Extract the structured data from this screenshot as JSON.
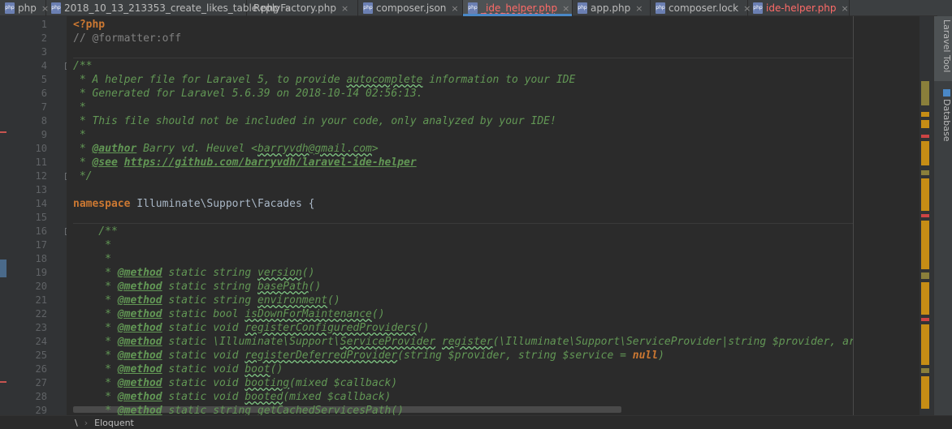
{
  "tabs": [
    {
      "label": "php",
      "icon": "php-file-icon",
      "active": false,
      "error": false
    },
    {
      "label": "2018_10_13_213353_create_likes_table.php",
      "icon": "php-file-icon",
      "active": false,
      "error": false
    },
    {
      "label": "ReplyFactory.php",
      "icon": "",
      "active": false,
      "error": false
    },
    {
      "label": "composer.json",
      "icon": "json-file-icon",
      "active": false,
      "error": false
    },
    {
      "label": "_ide_helper.php",
      "icon": "php-file-icon",
      "active": true,
      "error": true
    },
    {
      "label": "app.php",
      "icon": "php-file-icon",
      "active": false,
      "error": false
    },
    {
      "label": "composer.lock",
      "icon": "lock-file-icon",
      "active": false,
      "error": false
    },
    {
      "label": "ide-helper.php",
      "icon": "php-file-icon",
      "active": false,
      "error": true
    }
  ],
  "close_glyph": "×",
  "file_icon_text": "php",
  "line_numbers": [
    "1",
    "2",
    "3",
    "4",
    "5",
    "6",
    "7",
    "8",
    "9",
    "10",
    "11",
    "12",
    "13",
    "14",
    "15",
    "16",
    "17",
    "18",
    "19",
    "20",
    "21",
    "22",
    "23",
    "24",
    "25",
    "26",
    "27",
    "28",
    "29"
  ],
  "code_lines": [
    [
      {
        "t": "<?php",
        "c": "kw"
      }
    ],
    [
      {
        "t": "// @formatter:off",
        "c": "cmt"
      }
    ],
    [],
    [
      {
        "t": "/**",
        "c": "doc"
      }
    ],
    [
      {
        "t": " * A helper file for Laravel 5, to provide ",
        "c": "doc"
      },
      {
        "t": "autocomplete",
        "c": "doc-ref"
      },
      {
        "t": " information to your IDE",
        "c": "doc"
      }
    ],
    [
      {
        "t": " * Generated for Laravel 5.6.39 on 2018-10-14 02:56:13.",
        "c": "doc"
      }
    ],
    [
      {
        "t": " *",
        "c": "doc"
      }
    ],
    [
      {
        "t": " * This file should not be included in your code, only analyzed by your IDE!",
        "c": "doc"
      }
    ],
    [
      {
        "t": " *",
        "c": "doc"
      }
    ],
    [
      {
        "t": " * ",
        "c": "doc"
      },
      {
        "t": "@author",
        "c": "tag"
      },
      {
        "t": " Barry vd. Heuvel <",
        "c": "doc"
      },
      {
        "t": "barryvdh@gmail.com",
        "c": "doc-ref"
      },
      {
        "t": ">",
        "c": "doc"
      }
    ],
    [
      {
        "t": " * ",
        "c": "doc"
      },
      {
        "t": "@see",
        "c": "tag"
      },
      {
        "t": " ",
        "c": "doc"
      },
      {
        "t": "https://github.com/barryvdh/laravel-ide-helper",
        "c": "doc-link"
      }
    ],
    [
      {
        "t": " */",
        "c": "doc"
      }
    ],
    [],
    [
      {
        "t": "namespace",
        "c": "kw"
      },
      {
        "t": " Illuminate\\Support\\Facades {",
        "c": ""
      }
    ],
    [],
    [
      {
        "t": "    /**",
        "c": "doc"
      }
    ],
    [
      {
        "t": "     *",
        "c": "doc"
      }
    ],
    [
      {
        "t": "     *",
        "c": "doc"
      }
    ],
    [
      {
        "t": "     * ",
        "c": "doc"
      },
      {
        "t": "@method",
        "c": "tag"
      },
      {
        "t": " static string ",
        "c": "doc"
      },
      {
        "t": "version",
        "c": "doc-ref"
      },
      {
        "t": "()",
        "c": "doc"
      }
    ],
    [
      {
        "t": "     * ",
        "c": "doc"
      },
      {
        "t": "@method",
        "c": "tag"
      },
      {
        "t": " static string ",
        "c": "doc"
      },
      {
        "t": "basePath",
        "c": "doc-ref"
      },
      {
        "t": "()",
        "c": "doc"
      }
    ],
    [
      {
        "t": "     * ",
        "c": "doc"
      },
      {
        "t": "@method",
        "c": "tag"
      },
      {
        "t": " static string ",
        "c": "doc"
      },
      {
        "t": "environment",
        "c": "doc-ref"
      },
      {
        "t": "()",
        "c": "doc"
      }
    ],
    [
      {
        "t": "     * ",
        "c": "doc"
      },
      {
        "t": "@method",
        "c": "tag"
      },
      {
        "t": " static bool ",
        "c": "doc"
      },
      {
        "t": "isDownForMaintenance",
        "c": "doc-ref"
      },
      {
        "t": "()",
        "c": "doc"
      }
    ],
    [
      {
        "t": "     * ",
        "c": "doc"
      },
      {
        "t": "@method",
        "c": "tag"
      },
      {
        "t": " static void ",
        "c": "doc"
      },
      {
        "t": "registerConfiguredProviders",
        "c": "doc-ref"
      },
      {
        "t": "()",
        "c": "doc"
      }
    ],
    [
      {
        "t": "     * ",
        "c": "doc"
      },
      {
        "t": "@method",
        "c": "tag"
      },
      {
        "t": " static \\Illuminate\\Support\\",
        "c": "doc"
      },
      {
        "t": "ServiceProvider",
        "c": "doc-ref"
      },
      {
        "t": " ",
        "c": "doc"
      },
      {
        "t": "register",
        "c": "doc-ref"
      },
      {
        "t": "(\\Illuminate\\Support\\ServiceProvider|string $provider, array $optio",
        "c": "doc"
      }
    ],
    [
      {
        "t": "     * ",
        "c": "doc"
      },
      {
        "t": "@method",
        "c": "tag"
      },
      {
        "t": " static void ",
        "c": "doc"
      },
      {
        "t": "registerDeferredProvider",
        "c": "doc-ref"
      },
      {
        "t": "(string $provider, string $service = ",
        "c": "doc"
      },
      {
        "t": "null",
        "c": "null"
      },
      {
        "t": ")",
        "c": "doc"
      }
    ],
    [
      {
        "t": "     * ",
        "c": "doc"
      },
      {
        "t": "@method",
        "c": "tag"
      },
      {
        "t": " static void ",
        "c": "doc"
      },
      {
        "t": "boot",
        "c": "doc-ref"
      },
      {
        "t": "()",
        "c": "doc"
      }
    ],
    [
      {
        "t": "     * ",
        "c": "doc"
      },
      {
        "t": "@method",
        "c": "tag"
      },
      {
        "t": " static void ",
        "c": "doc"
      },
      {
        "t": "booting",
        "c": "doc-ref"
      },
      {
        "t": "(mixed $callback)",
        "c": "doc"
      }
    ],
    [
      {
        "t": "     * ",
        "c": "doc"
      },
      {
        "t": "@method",
        "c": "tag"
      },
      {
        "t": " static void ",
        "c": "doc"
      },
      {
        "t": "booted",
        "c": "doc-ref"
      },
      {
        "t": "(mixed $callback)",
        "c": "doc"
      }
    ],
    [
      {
        "t": "     * ",
        "c": "doc"
      },
      {
        "t": "@method",
        "c": "tag"
      },
      {
        "t": " static string ",
        "c": "doc"
      },
      {
        "t": "getCachedServicesPath",
        "c": "doc-ref"
      },
      {
        "t": "()",
        "c": "doc"
      }
    ]
  ],
  "right_tool_tabs": [
    "Laravel Tool",
    "Database"
  ],
  "breadcrumb": {
    "sep": "\\",
    "arrow": "›",
    "item": "Eloquent"
  },
  "colors": {
    "accent": "#4a88c7",
    "error": "#ff6b68",
    "doc_comment": "#629755",
    "keyword": "#cc7832"
  }
}
